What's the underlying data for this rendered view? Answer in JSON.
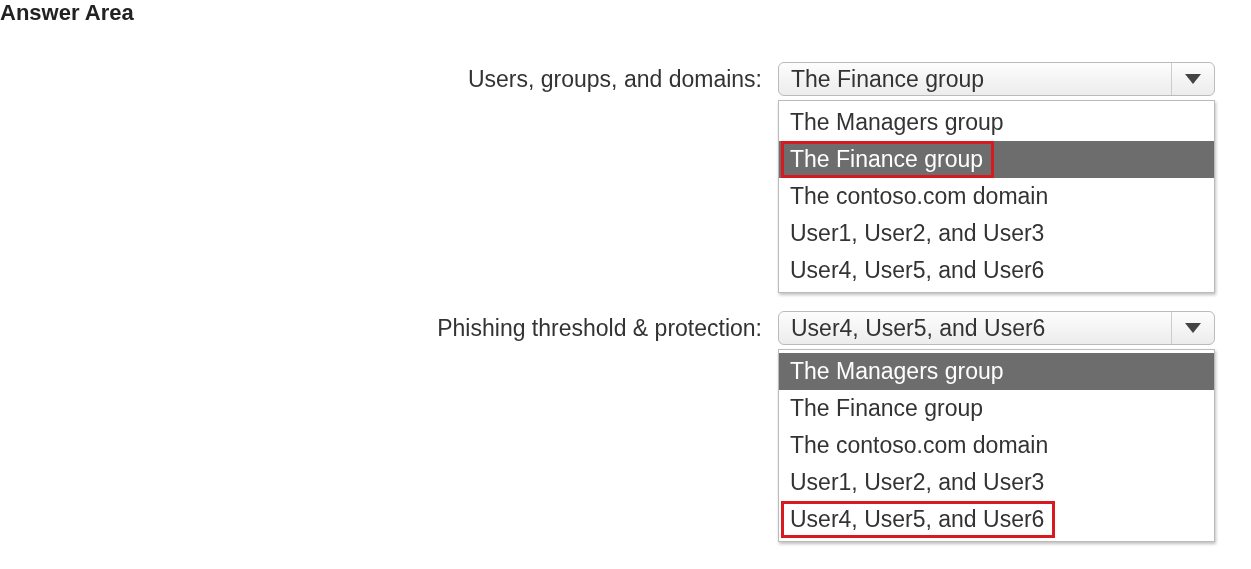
{
  "title": "Answer Area",
  "fields": [
    {
      "label": "Users, groups, and domains:",
      "value": "The Finance group",
      "expanded": true,
      "options": [
        {
          "text": "The Managers group",
          "highlighted": false,
          "marked": false
        },
        {
          "text": "The Finance group",
          "highlighted": true,
          "marked": true
        },
        {
          "text": "The contoso.com domain",
          "highlighted": false,
          "marked": false
        },
        {
          "text": "User1, User2, and User3",
          "highlighted": false,
          "marked": false
        },
        {
          "text": "User4, User5, and User6",
          "highlighted": false,
          "marked": false
        }
      ]
    },
    {
      "label": "Phishing threshold & protection:",
      "value": "User4, User5, and User6",
      "expanded": true,
      "options": [
        {
          "text": "The Managers group",
          "highlighted": true,
          "marked": false
        },
        {
          "text": "The Finance group",
          "highlighted": false,
          "marked": false
        },
        {
          "text": "The contoso.com domain",
          "highlighted": false,
          "marked": false
        },
        {
          "text": "User1, User2, and User3",
          "highlighted": false,
          "marked": false
        },
        {
          "text": "User4, User5, and User6",
          "highlighted": false,
          "marked": true
        }
      ]
    }
  ]
}
